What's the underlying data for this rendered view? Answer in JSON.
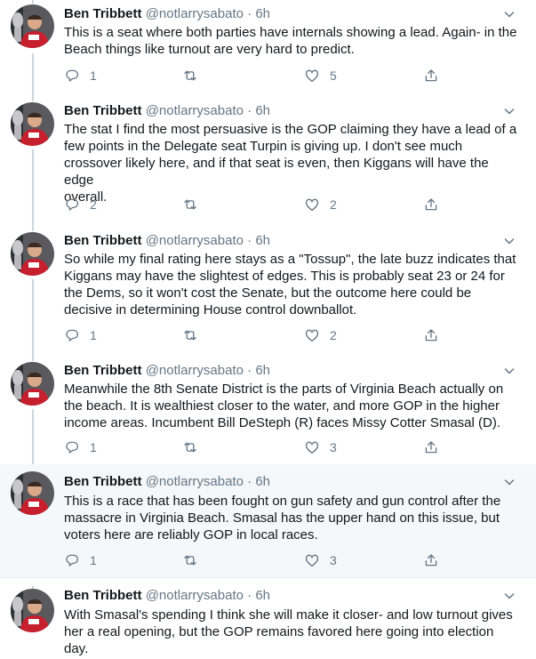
{
  "colors": {
    "text": "#14171a",
    "secondary": "#657786",
    "thread_line": "#ccd6dd",
    "highlight_bg": "#f5f8fa",
    "border": "#e6ecf0"
  },
  "icons": [
    "reply-icon",
    "retweet-icon",
    "like-icon",
    "share-icon",
    "chevron-down-icon"
  ],
  "tweets": [
    {
      "author": "Ben Tribbett",
      "handle": "@notlarrysabato",
      "separator": "·",
      "time": "6h",
      "lines": [
        "This is a seat where both parties have internals showing a lead.  Again- in the",
        "Beach things like turnout are very hard to predict."
      ],
      "replies": "1",
      "retweets": "",
      "likes": "5"
    },
    {
      "author": "Ben Tribbett",
      "handle": "@notlarrysabato",
      "separator": "·",
      "time": "6h",
      "lines": [
        "The stat I find the most persuasive is the GOP claiming they have a lead of a",
        "few points in the Delegate seat Turpin is giving up.  I don't see much",
        "crossover likely here, and if that seat is even, then Kiggans will have the edge",
        "overall."
      ],
      "replies": "2",
      "retweets": "",
      "likes": "2"
    },
    {
      "author": "Ben Tribbett",
      "handle": "@notlarrysabato",
      "separator": "·",
      "time": "6h",
      "lines": [
        "So while my final rating here stays as a \"Tossup\", the late buzz indicates that",
        "Kiggans may have the slightest of edges.  This is probably seat 23 or 24 for",
        "the Dems, so it won't cost the Senate, but the outcome here could be",
        "decisive in determining House control downballot."
      ],
      "replies": "1",
      "retweets": "",
      "likes": "2"
    },
    {
      "author": "Ben Tribbett",
      "handle": "@notlarrysabato",
      "separator": "·",
      "time": "6h",
      "lines": [
        "Meanwhile the 8th Senate District is the parts of Virginia Beach actually on",
        "the beach.  It is wealthiest closer to the water, and more GOP in the higher",
        "income areas.  Incumbent Bill DeSteph (R) faces Missy Cotter Smasal (D)."
      ],
      "replies": "1",
      "retweets": "",
      "likes": "3"
    },
    {
      "author": "Ben Tribbett",
      "handle": "@notlarrysabato",
      "separator": "·",
      "time": "6h",
      "lines": [
        "This is a race that has been fought on gun safety and gun control after the",
        "massacre in Virginia Beach.  Smasal has the upper hand on this issue, but",
        "voters here are reliably GOP in local races."
      ],
      "replies": "1",
      "retweets": "",
      "likes": "3"
    },
    {
      "author": "Ben Tribbett",
      "handle": "@notlarrysabato",
      "separator": "·",
      "time": "6h",
      "lines": [
        "With Smasal's spending I think she will make it closer- and low turnout gives",
        "her a real opening, but the GOP remains favored here going into election",
        "day."
      ],
      "replies": "",
      "retweets": "",
      "likes": ""
    }
  ]
}
